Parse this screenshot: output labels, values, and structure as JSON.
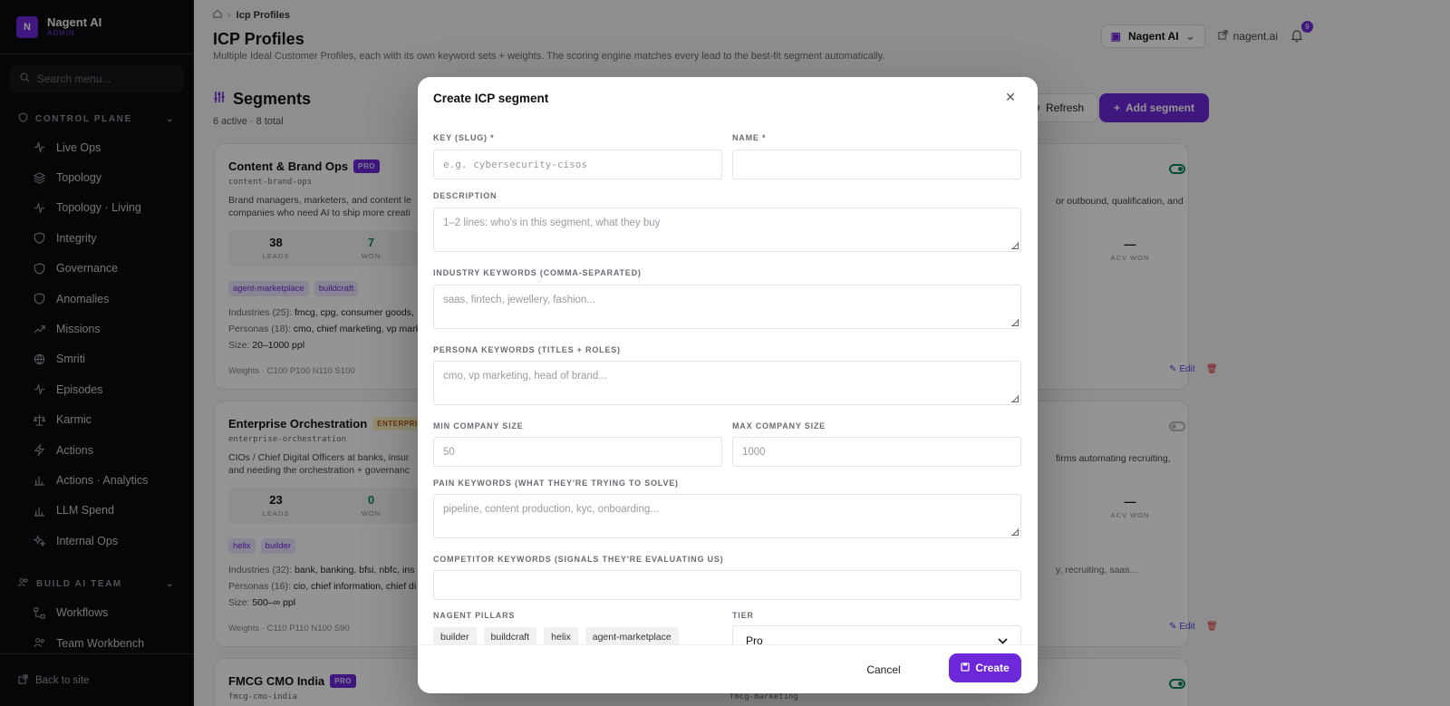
{
  "sidebar": {
    "brand_initial": "N",
    "brand_name": "Nagent AI",
    "brand_role": "ADMIN",
    "search_placeholder": "Search menu...",
    "section_control": "CONTROL PLANE",
    "control_items": [
      {
        "label": "Live Ops",
        "icon": "pulse-icon"
      },
      {
        "label": "Topology",
        "icon": "layers-icon"
      },
      {
        "label": "Topology · Living",
        "icon": "pulse-icon"
      },
      {
        "label": "Integrity",
        "icon": "shield-icon"
      },
      {
        "label": "Governance",
        "icon": "shield-icon"
      },
      {
        "label": "Anomalies",
        "icon": "shield-icon"
      },
      {
        "label": "Missions",
        "icon": "trend-icon"
      },
      {
        "label": "Smriti",
        "icon": "globe-icon"
      },
      {
        "label": "Episodes",
        "icon": "pulse-icon"
      },
      {
        "label": "Karmic",
        "icon": "scale-icon"
      },
      {
        "label": "Actions",
        "icon": "bolt-icon"
      },
      {
        "label": "Actions · Analytics",
        "icon": "bar-chart-icon"
      },
      {
        "label": "LLM Spend",
        "icon": "bar-chart-icon"
      },
      {
        "label": "Internal Ops",
        "icon": "sparkle-icon"
      }
    ],
    "section_build": "BUILD AI TEAM",
    "build_items": [
      {
        "label": "Workflows",
        "icon": "workflow-icon"
      },
      {
        "label": "Team Workbench",
        "icon": "people-icon"
      }
    ],
    "back_label": "Back to site"
  },
  "header": {
    "breadcrumb_current": "Icp Profiles",
    "title": "ICP Profiles",
    "subtitle": "Multiple Ideal Customer Profiles, each with its own keyword sets + weights. The scoring engine matches every lead to the best-fit segment automatically.",
    "org_name": "Nagent AI",
    "site_link": "nagent.ai",
    "notif_count": "9"
  },
  "segments": {
    "title": "Segments",
    "count": "6 active · 8 total",
    "refresh_label": "Refresh",
    "add_label": "Add segment"
  },
  "cards": {
    "c1": {
      "name": "Content & Brand Ops",
      "badge": "PRO",
      "slug": "content-brand-ops",
      "desc1": "Brand managers, marketers, and content le",
      "desc2": "companies who need AI to ship more creati",
      "leads": "38",
      "leads_label": "LEADS",
      "won": "7",
      "won_label": "WON",
      "pillars": [
        "agent-marketplace",
        "buildcraft"
      ],
      "industries_label": "Industries (25):",
      "industries": "fmcg, cpg, consumer goods,",
      "personas_label": "Personas (18):",
      "personas": "cmo, chief marketing, vp mark",
      "size_label": "Size:",
      "size": "20–1000 ppl",
      "weights": "Weights · C100 P100 N110 S100"
    },
    "c2": {
      "name": "Enterprise Orchestration",
      "badge": "ENTERPRISE",
      "slug": "enterprise-orchestration",
      "desc1": "CIOs / Chief Digital Officers at banks, insur",
      "desc2": "and needing the orchestration + governanc",
      "leads": "23",
      "leads_label": "LEADS",
      "won": "0",
      "won_label": "WON",
      "pillars": [
        "helix",
        "builder"
      ],
      "industries_label": "Industries (32):",
      "industries": "bank, banking, bfsi, nbfc, ins",
      "personas_label": "Personas (16):",
      "personas": "cio, chief information, chief di",
      "size_label": "Size:",
      "size": "500–∞ ppl",
      "weights": "Weights · C110 P110 N100 S90"
    },
    "c3": {
      "name": "FMCG CMO India",
      "badge": "PRO",
      "slug": "fmcg-cmo-india"
    },
    "r1": {
      "desc": "or outbound, qualification, and",
      "acv": "—",
      "acv_label": "ACV WON",
      "edit": "Edit"
    },
    "r2": {
      "desc": "firms automating recruiting,",
      "keywords": "y, recruiting, saas...",
      "acv": "—",
      "acv_label": "ACV WON",
      "edit": "Edit"
    },
    "r3": {
      "slug": "fmcg-marketing"
    }
  },
  "modal": {
    "title": "Create ICP segment",
    "key_label": "KEY (SLUG) *",
    "key_placeholder": "e.g. cybersecurity-cisos",
    "name_label": "NAME *",
    "name_value": "",
    "desc_label": "DESCRIPTION",
    "desc_placeholder": "1–2 lines: who's in this segment, what they buy",
    "industry_label": "INDUSTRY KEYWORDS (COMMA-SEPARATED)",
    "industry_placeholder": "saas, fintech, jewellery, fashion...",
    "persona_label": "PERSONA KEYWORDS (TITLES + ROLES)",
    "persona_placeholder": "cmo, vp marketing, head of brand...",
    "min_label": "MIN COMPANY SIZE",
    "min_placeholder": "50",
    "max_label": "MAX COMPANY SIZE",
    "max_placeholder": "1000",
    "pain_label": "PAIN KEYWORDS (WHAT THEY'RE TRYING TO SOLVE)",
    "pain_placeholder": "pipeline, content production, kyc, onboarding...",
    "competitor_label": "COMPETITOR KEYWORDS (SIGNALS THEY'RE EVALUATING US)",
    "competitor_value": "",
    "pillars_label": "NAGENT PILLARS",
    "pillars": [
      "builder",
      "buildcraft",
      "helix",
      "agent-marketplace"
    ],
    "tier_label": "TIER",
    "tier_value": "Pro",
    "cancel_label": "Cancel",
    "create_label": "Create"
  },
  "colors": {
    "accent": "#6d28d9",
    "success": "#0d8a5a",
    "danger": "#dc2626"
  }
}
